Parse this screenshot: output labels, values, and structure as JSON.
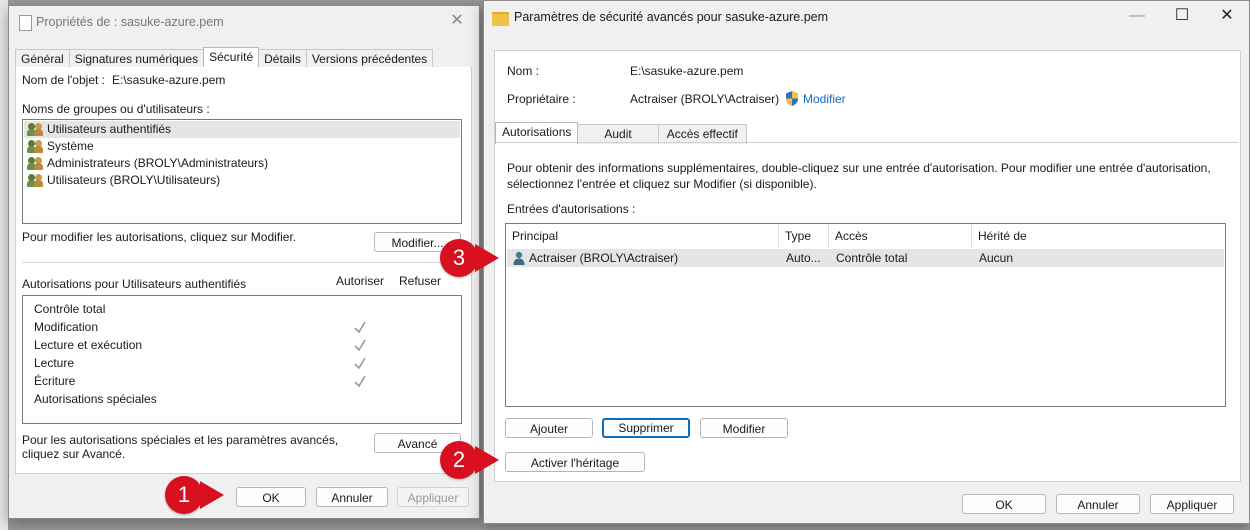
{
  "properties_window": {
    "title": "Propriétés de : sasuke-azure.pem",
    "tabs": [
      "Général",
      "Signatures numériques",
      "Sécurité",
      "Détails",
      "Versions précédentes"
    ],
    "object_name_label": "Nom de l'objet :",
    "object_name_value": "E:\\sasuke-azure.pem",
    "groups_label": "Noms de groupes ou d'utilisateurs :",
    "users": [
      "Utilisateurs authentifiés",
      "Système",
      "Administrateurs (BROLY\\Administrateurs)",
      "Utilisateurs (BROLY\\Utilisateurs)"
    ],
    "modify_hint": "Pour modifier les autorisations, cliquez sur Modifier.",
    "modify_button": "Modifier...",
    "permissions_for": "Autorisations pour Utilisateurs authentifiés",
    "allow_header": "Autoriser",
    "deny_header": "Refuser",
    "permissions": [
      {
        "name": "Contrôle total",
        "allow": false
      },
      {
        "name": "Modification",
        "allow": true
      },
      {
        "name": "Lecture et exécution",
        "allow": true
      },
      {
        "name": "Lecture",
        "allow": true
      },
      {
        "name": "Écriture",
        "allow": true
      },
      {
        "name": "Autorisations spéciales",
        "allow": false
      }
    ],
    "advanced_hint": "Pour les autorisations spéciales et les paramètres avancés, cliquez sur Avancé.",
    "advanced_button": "Avancé",
    "ok_button": "OK",
    "cancel_button": "Annuler",
    "apply_button": "Appliquer"
  },
  "advanced_window": {
    "title": "Paramètres de sécurité avancés pour sasuke-azure.pem",
    "name_label": "Nom :",
    "name_value": "E:\\sasuke-azure.pem",
    "owner_label": "Propriétaire :",
    "owner_value": "Actraiser (BROLY\\Actraiser)",
    "owner_modify_link": "Modifier",
    "tabs": [
      "Autorisations",
      "Audit",
      "Accès effectif"
    ],
    "info_text": "Pour obtenir des informations supplémentaires, double-cliquez sur une entrée d'autorisation. Pour modifier une entrée d'autorisation, sélectionnez l'entrée et cliquez sur Modifier (si disponible).",
    "entries_label": "Entrées d'autorisations :",
    "columns": [
      "Principal",
      "Type",
      "Accès",
      "Hérité de"
    ],
    "entries": [
      {
        "principal": "Actraiser (BROLY\\Actraiser)",
        "type": "Auto...",
        "access": "Contrôle total",
        "inherited": "Aucun"
      }
    ],
    "add_button": "Ajouter",
    "remove_button": "Supprimer",
    "modify_button": "Modifier",
    "inheritance_button": "Activer l'héritage",
    "ok_button": "OK",
    "cancel_button": "Annuler",
    "apply_button": "Appliquer"
  },
  "markers": [
    "1",
    "2",
    "3"
  ],
  "colors": {
    "marker": "#d80f1f",
    "link": "#0f6cbd",
    "focus": "#0f6cbd"
  }
}
